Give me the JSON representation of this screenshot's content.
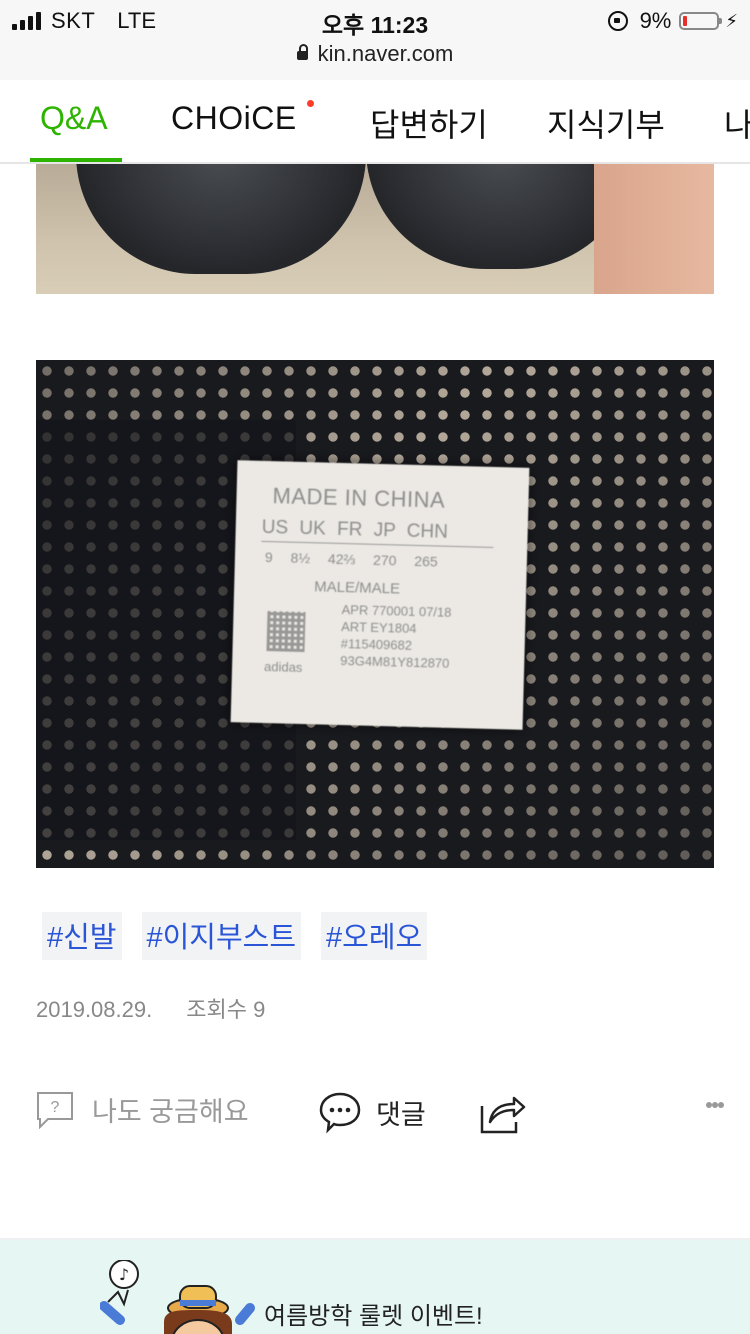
{
  "status_bar": {
    "carrier": "SKT",
    "network": "LTE",
    "time": "오후 11:23",
    "url": "kin.naver.com",
    "battery": "9%",
    "icons": [
      "signal-icon",
      "lock-icon",
      "rotation-lock-icon",
      "battery-icon",
      "charging-icon"
    ]
  },
  "tabs": [
    {
      "label": "Q&A",
      "active": true
    },
    {
      "label": "CHOiCE",
      "new_dot": true
    },
    {
      "label": "답변하기"
    },
    {
      "label": "지식기부"
    },
    {
      "label": "나"
    }
  ],
  "tags": [
    "#신발",
    "#이지부스트",
    "#오레오"
  ],
  "meta": {
    "date": "2019.08.29.",
    "views": "조회수 9"
  },
  "actions": {
    "curious_label": "나도 궁금해요",
    "comment_label": "댓글"
  },
  "label_text": {
    "title": "MADE IN CHINA",
    "sizes": "US UK FR JP CHN",
    "values": "9 8½ 42⅔ 270 265",
    "gender": "MALE/MALE",
    "codes": [
      "APR 770001 07/18",
      "ART EY1804",
      "#115409682",
      "93G4M81Y812870"
    ],
    "brand": "adidas"
  },
  "banner": {
    "text": "여름방학 룰렛 이벤트!"
  },
  "colors": {
    "accent_green": "#2db400",
    "tag_blue": "#2a55d6",
    "banner_bg": "#e6f7f3",
    "new_dot": "#ff3c28"
  }
}
